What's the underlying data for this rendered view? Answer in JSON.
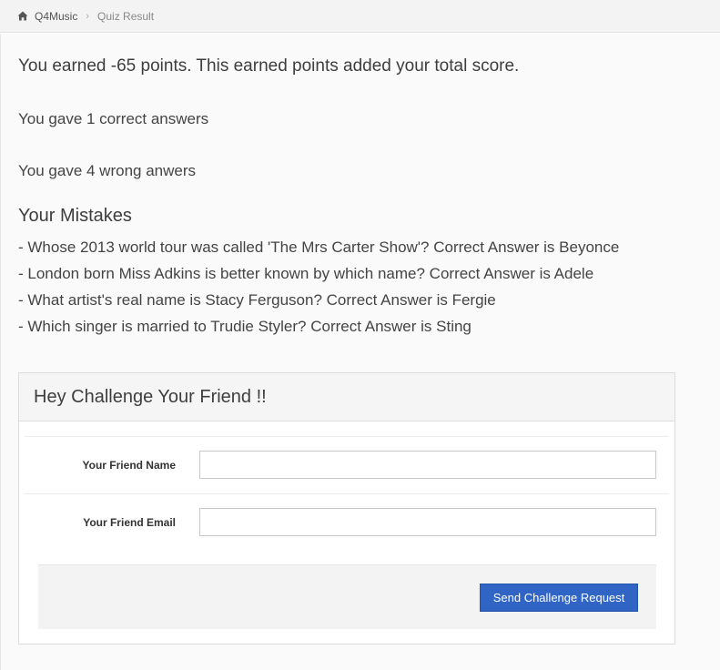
{
  "breadcrumb": {
    "items": [
      "Q4Music",
      "Quiz Result"
    ]
  },
  "result": {
    "summary": "You earned -65 points. This earned points added your total score.",
    "correct": "You gave 1 correct answers",
    "wrong": "You gave 4 wrong anwers"
  },
  "mistakes": {
    "title": "Your Mistakes",
    "items": [
      "- Whose 2013 world tour was called 'The Mrs Carter Show'? Correct Answer is Beyonce",
      "- London born Miss Adkins is better known by which name? Correct Answer is Adele",
      "- What artist's real name is Stacy Ferguson? Correct Answer is Fergie",
      "- Which singer is married to Trudie Styler? Correct Answer is Sting"
    ]
  },
  "challenge": {
    "title": "Hey Challenge Your Friend !!",
    "name_label": "Your Friend Name",
    "name_value": "",
    "email_label": "Your Friend Email",
    "email_value": "",
    "send_label": "Send Challenge Request"
  },
  "colors": {
    "button": "#3065c6"
  },
  "icons": {
    "home": "home-icon",
    "separator": "chevron-right-icon"
  }
}
